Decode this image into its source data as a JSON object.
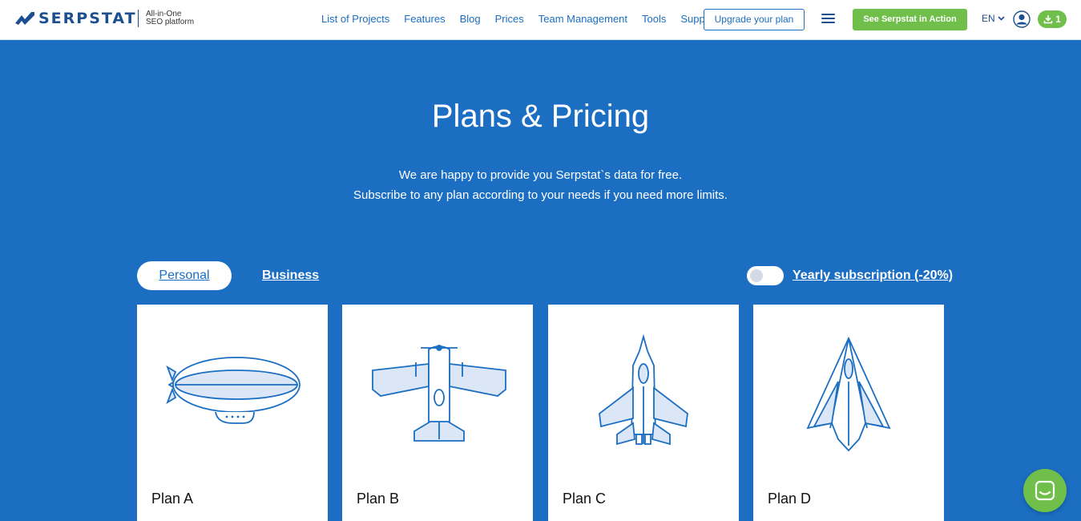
{
  "header": {
    "logo_text": "SERPSTAT",
    "tagline_line1": "All-in-One",
    "tagline_line2": "SEO platform",
    "nav": [
      "List of Projects",
      "Features",
      "Blog",
      "Prices",
      "Team Management",
      "Tools",
      "Support"
    ],
    "upgrade_label": "Upgrade your plan",
    "demo_label": "See Serpstat in Action",
    "language": "EN",
    "download_count": "1"
  },
  "hero": {
    "title": "Plans & Pricing",
    "subtitle_line1": "We are happy to provide you Serpstat`s data for free.",
    "subtitle_line2": "Subscribe to any plan according to your needs if you need more limits."
  },
  "toggles": {
    "personal_label": "Personal",
    "business_label": "Business",
    "yearly_label": "Yearly subscription (-20%)",
    "yearly_enabled": false
  },
  "plans": [
    {
      "name": "Plan A",
      "icon": "airship-icon"
    },
    {
      "name": "Plan B",
      "icon": "propeller-plane-icon"
    },
    {
      "name": "Plan C",
      "icon": "fighter-jet-icon"
    },
    {
      "name": "Plan D",
      "icon": "stealth-jet-icon"
    }
  ],
  "colors": {
    "brand_blue": "#1b6ec2",
    "dark_blue": "#1b4f8f",
    "accent_green": "#6fbf4a"
  }
}
